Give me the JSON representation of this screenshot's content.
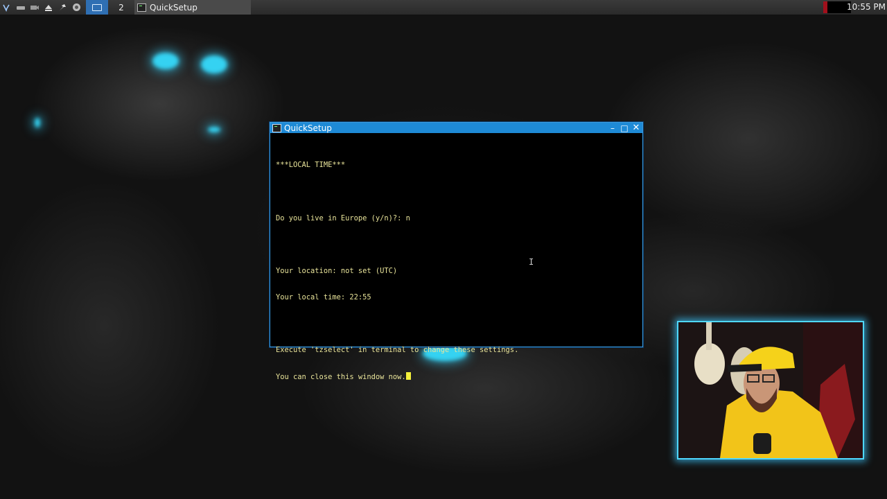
{
  "taskbar": {
    "workspace_2_label": "2",
    "task_title": "QuickSetup",
    "clock": "10:55 PM",
    "launcher_icons": [
      "menu-icon",
      "drive-icon",
      "camera-icon",
      "eject-icon",
      "pin-icon",
      "browser-icon"
    ]
  },
  "window": {
    "title": "QuickSetup",
    "controls": {
      "minimize": "–",
      "maximize": "□",
      "close": "✕"
    }
  },
  "terminal": {
    "lines": [
      "***LOCAL TIME***",
      "",
      "Do you live in Europe (y/n)?: n",
      "",
      "Your location: not set (UTC)",
      "Your local time: 22:55",
      "",
      "Execute 'tzselect' in terminal to change these settings.",
      "You can close this window now."
    ]
  },
  "colors": {
    "titlebar": "#1e8ad6",
    "terminal_text": "#e9e49a",
    "cursor": "#f3ef3a",
    "webcam_border": "#4fd8ff",
    "accent_glow": "#35d2f2"
  }
}
